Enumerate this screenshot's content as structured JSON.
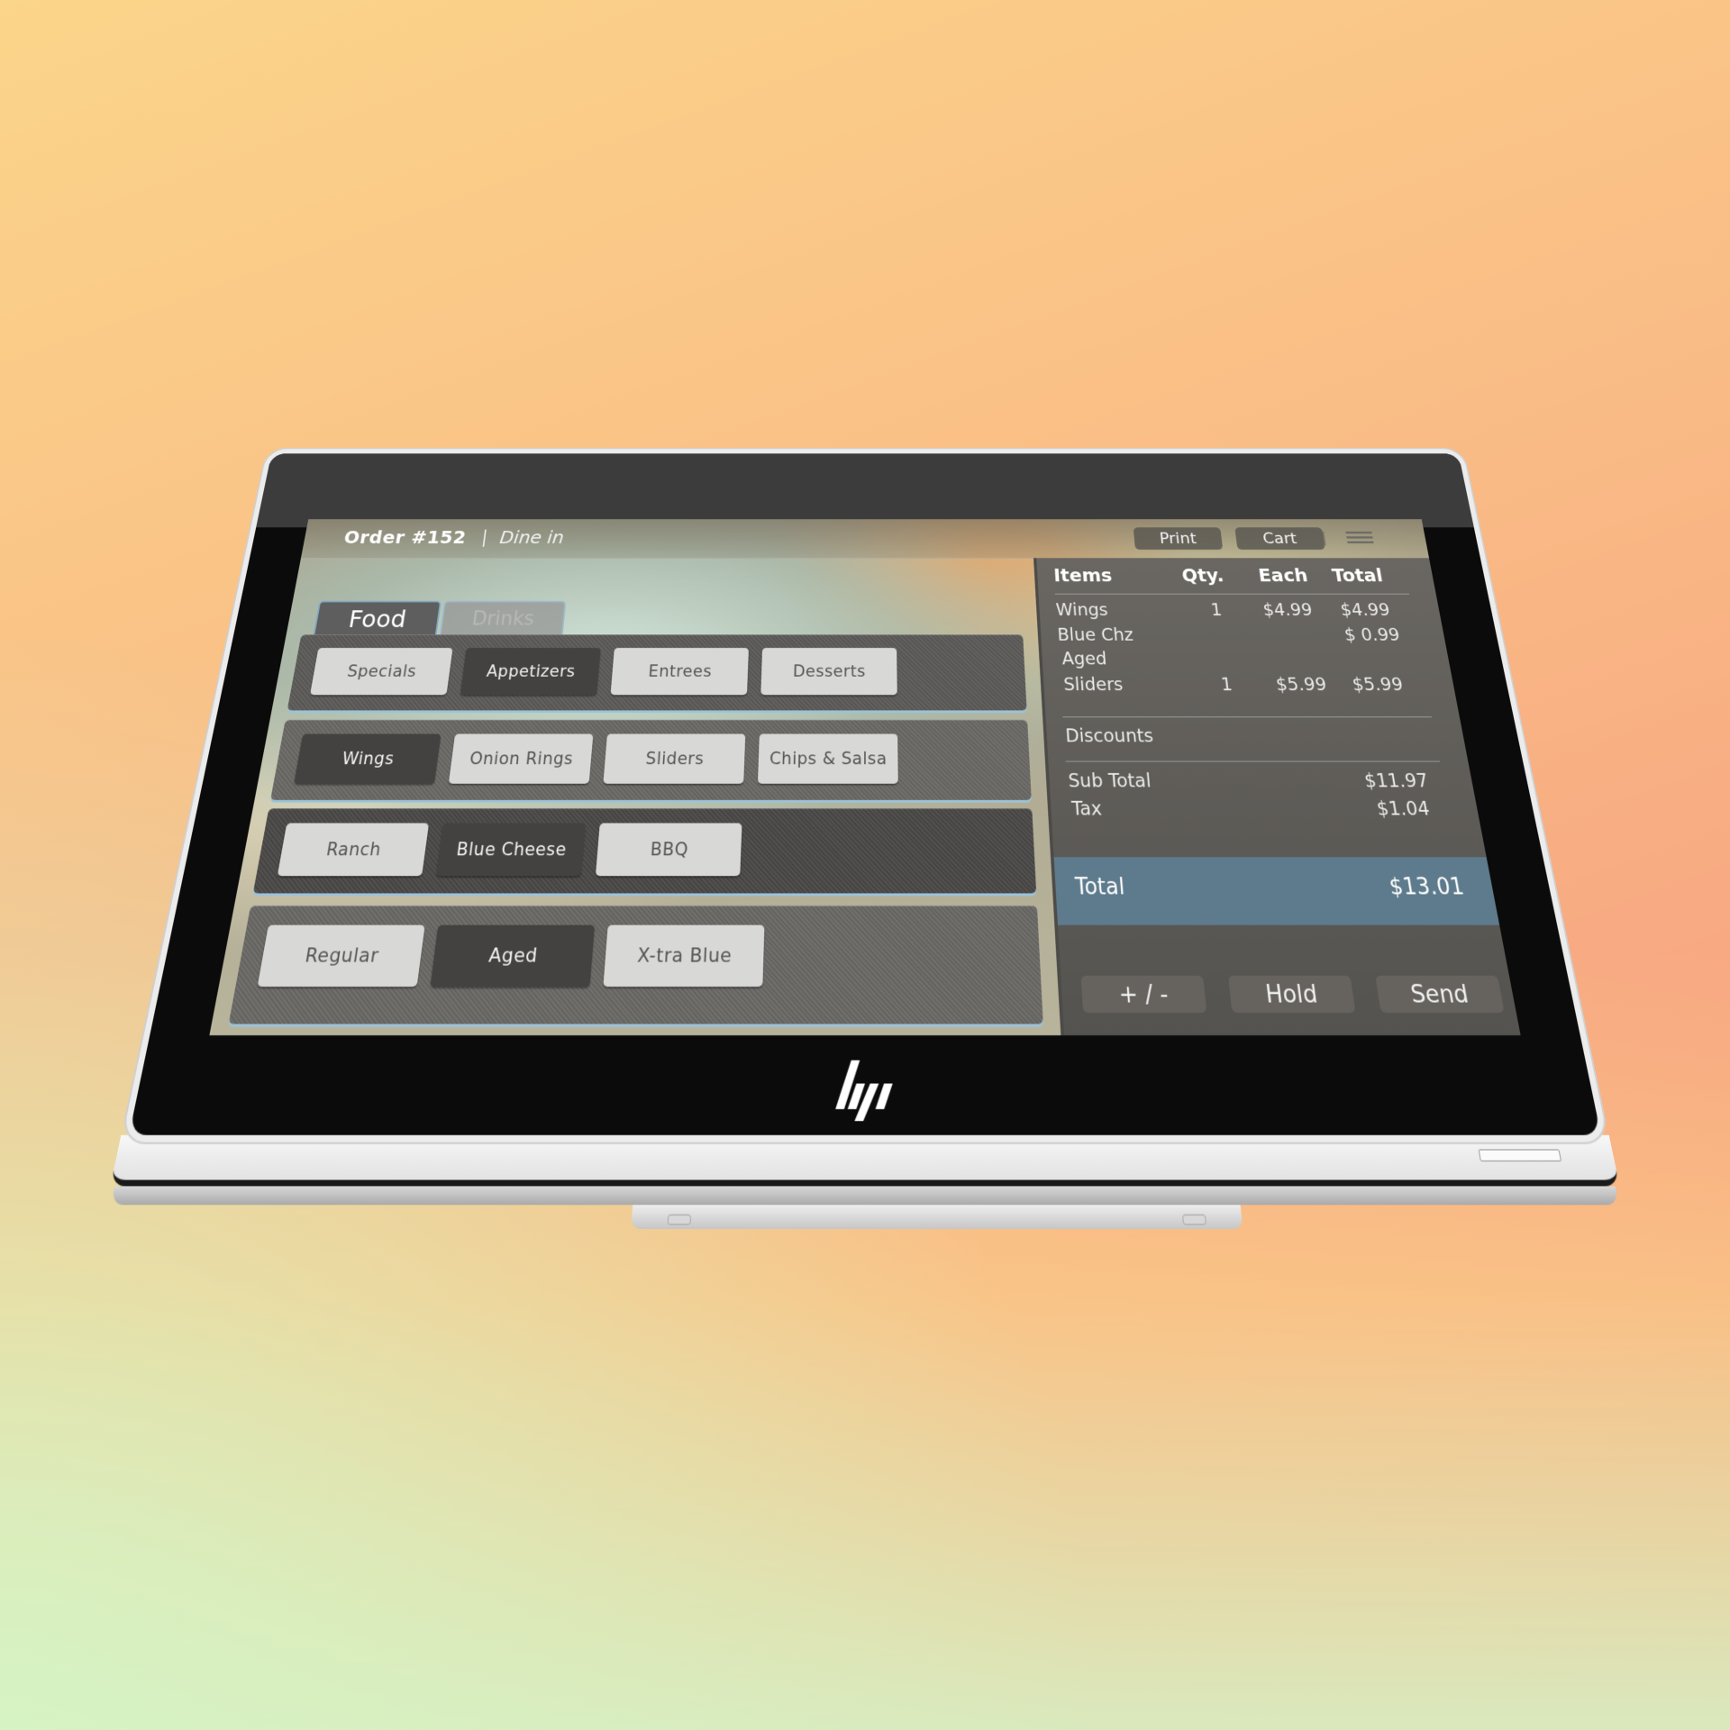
{
  "header": {
    "order_title": "Order #152",
    "separator": "|",
    "order_type": "Dine in",
    "buttons": [
      {
        "label": "Print"
      },
      {
        "label": "Cart"
      }
    ],
    "menu_icon": "hamburger-menu-icon"
  },
  "tabs": [
    {
      "label": "Food",
      "active": true
    },
    {
      "label": "Drinks",
      "active": false
    }
  ],
  "rows": [
    {
      "name": "categories",
      "buttons": [
        {
          "label": "Specials",
          "selected": false
        },
        {
          "label": "Appetizers",
          "selected": true
        },
        {
          "label": "Entrees",
          "selected": false
        },
        {
          "label": "Desserts",
          "selected": false
        }
      ]
    },
    {
      "name": "appetizers",
      "buttons": [
        {
          "label": "Wings",
          "selected": true
        },
        {
          "label": "Onion Rings",
          "selected": false
        },
        {
          "label": "Sliders",
          "selected": false
        },
        {
          "label": "Chips & Salsa",
          "selected": false
        }
      ]
    },
    {
      "name": "sauces",
      "buttons": [
        {
          "label": "Ranch",
          "selected": false
        },
        {
          "label": "Blue Cheese",
          "selected": true
        },
        {
          "label": "BBQ",
          "selected": false
        }
      ]
    },
    {
      "name": "blue-cheese-options",
      "buttons": [
        {
          "label": "Regular",
          "selected": false
        },
        {
          "label": "Aged",
          "selected": true
        },
        {
          "label": "X-tra Blue",
          "selected": false
        }
      ]
    }
  ],
  "order": {
    "columns": [
      "Items",
      "Qty.",
      "Each",
      "Total"
    ],
    "items": [
      {
        "name": "Wings",
        "qty": "1",
        "each": "$4.99",
        "total": "$4.99"
      },
      {
        "name": "Blue Chz",
        "qty": "",
        "each": "",
        "total": "$ 0.99"
      },
      {
        "name": "Aged",
        "qty": "",
        "each": "",
        "total": ""
      },
      {
        "name": "Sliders",
        "qty": "1",
        "each": "$5.99",
        "total": "$5.99"
      }
    ],
    "discounts_label": "Discounts",
    "subtotal_label": "Sub Total",
    "subtotal": "$11.97",
    "tax_label": "Tax",
    "tax": "$1.04",
    "total_label": "Total",
    "total": "$13.01",
    "actions": [
      {
        "label": "+ / -"
      },
      {
        "label": "Hold"
      },
      {
        "label": "Send"
      }
    ]
  },
  "device": {
    "brand_logo": "hp-logo"
  },
  "colors": {
    "accent_total_bar": "#5d7b8c",
    "selected_button": "#434240",
    "unselected_button": "#d8d8d6",
    "row_highlight": "#9bc3d9"
  }
}
